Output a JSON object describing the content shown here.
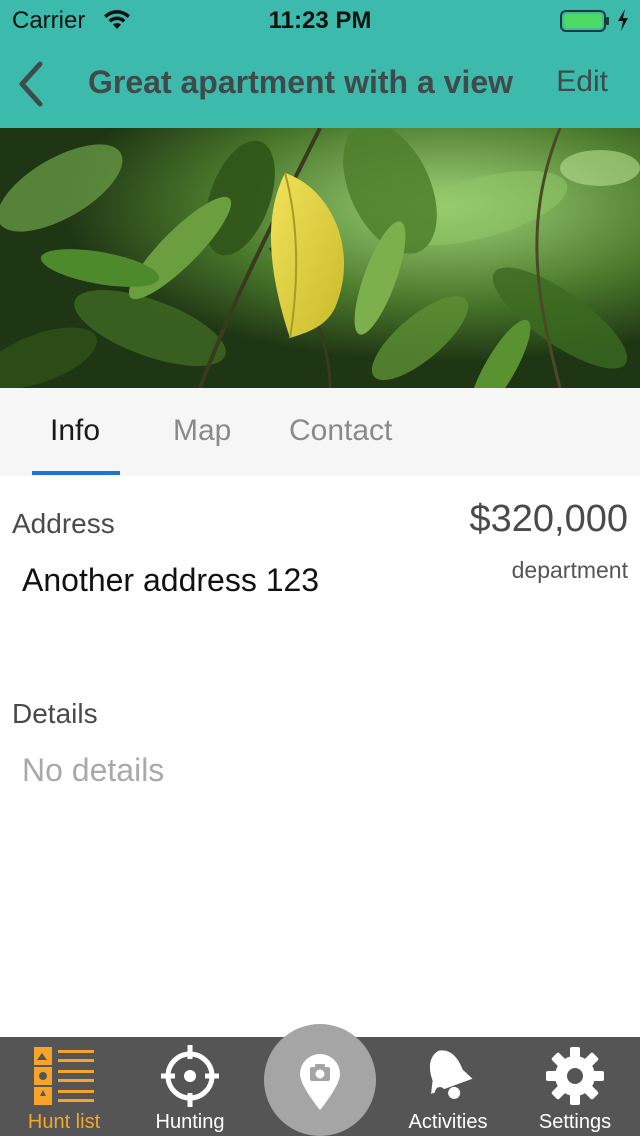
{
  "status_bar": {
    "carrier": "Carrier",
    "time": "11:23 PM",
    "icons": [
      "wifi-icon",
      "battery-icon",
      "charging-bolt-icon"
    ],
    "battery_color": "#4cd964"
  },
  "nav": {
    "back_icon": "chevron-left-icon",
    "title": "Great apartment with a view",
    "edit_label": "Edit",
    "background": "#3cbbad"
  },
  "hero": {
    "subject": "green-leaves-photo"
  },
  "tabs": [
    {
      "label": "Info",
      "active": true
    },
    {
      "label": "Map",
      "active": false
    },
    {
      "label": "Contact",
      "active": false
    }
  ],
  "tab_accent": "#1e73d8",
  "info": {
    "address_label": "Address",
    "address_value": "Another address 123",
    "price": "$320,000",
    "property_type": "department",
    "details_label": "Details",
    "details_value": "No details"
  },
  "tabbar": {
    "items": [
      {
        "label": "Hunt list",
        "icon": "list-icon",
        "active": true
      },
      {
        "label": "Hunting",
        "icon": "crosshair-icon",
        "active": false
      },
      {
        "label": "Activities",
        "icon": "bell-icon",
        "active": false
      },
      {
        "label": "Settings",
        "icon": "gear-icon",
        "active": false
      }
    ],
    "center_icon": "camera-pin-icon",
    "active_color": "#f7a42a",
    "background": "#555555"
  }
}
